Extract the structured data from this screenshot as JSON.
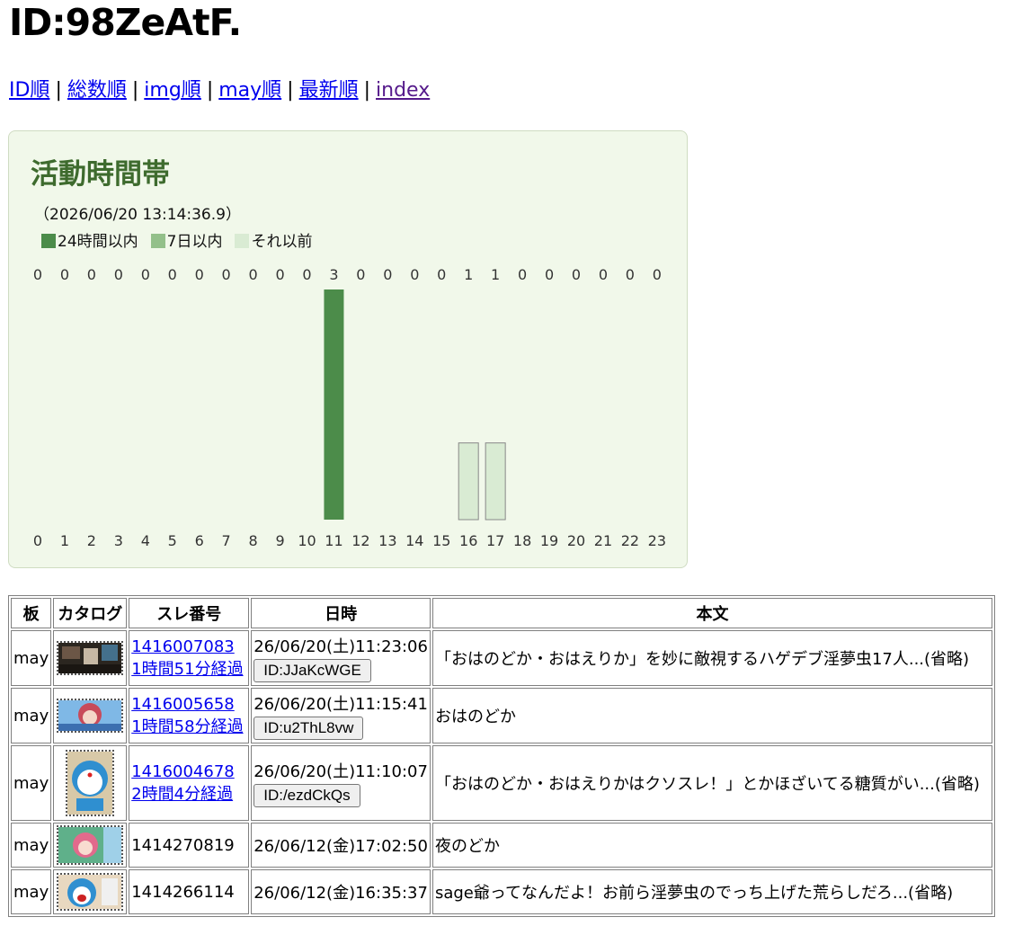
{
  "page": {
    "title": "ID:98ZeAtF."
  },
  "nav": [
    {
      "label": "ID順",
      "visited": false
    },
    {
      "label": "総数順",
      "visited": false
    },
    {
      "label": "img順",
      "visited": false
    },
    {
      "label": "may順",
      "visited": false
    },
    {
      "label": "最新順",
      "visited": false
    },
    {
      "label": "index",
      "visited": true
    }
  ],
  "nav_separator": "|",
  "activity": {
    "title": "活動時間帯",
    "timestamp": "（2026/06/20 13:14:36.9）",
    "legend": [
      {
        "label": "24時間以内",
        "color": "#4c8c4a"
      },
      {
        "label": "7日以内",
        "color": "#93c08a"
      },
      {
        "label": "それ以前",
        "color": "#d9ebd3"
      }
    ]
  },
  "chart_data": {
    "type": "bar",
    "categories": [
      "0",
      "1",
      "2",
      "3",
      "4",
      "5",
      "6",
      "7",
      "8",
      "9",
      "10",
      "11",
      "12",
      "13",
      "14",
      "15",
      "16",
      "17",
      "18",
      "19",
      "20",
      "21",
      "22",
      "23"
    ],
    "values": [
      0,
      0,
      0,
      0,
      0,
      0,
      0,
      0,
      0,
      0,
      0,
      3,
      0,
      0,
      0,
      0,
      1,
      1,
      0,
      0,
      0,
      0,
      0,
      0
    ],
    "series": [
      {
        "name": "24時間以内",
        "values": [
          0,
          0,
          0,
          0,
          0,
          0,
          0,
          0,
          0,
          0,
          0,
          3,
          0,
          0,
          0,
          0,
          0,
          0,
          0,
          0,
          0,
          0,
          0,
          0
        ]
      },
      {
        "name": "7日以内",
        "values": [
          0,
          0,
          0,
          0,
          0,
          0,
          0,
          0,
          0,
          0,
          0,
          0,
          0,
          0,
          0,
          0,
          0,
          0,
          0,
          0,
          0,
          0,
          0,
          0
        ]
      },
      {
        "name": "それ以前",
        "values": [
          0,
          0,
          0,
          0,
          0,
          0,
          0,
          0,
          0,
          0,
          0,
          0,
          0,
          0,
          0,
          0,
          1,
          1,
          0,
          0,
          0,
          0,
          0,
          0
        ]
      }
    ],
    "ylim": [
      0,
      3
    ],
    "colors": {
      "recent": "#4c8c4a",
      "week": "#93c08a",
      "older": "#d9ebd3",
      "border": "#888888"
    }
  },
  "table": {
    "headers": [
      "板",
      "カタログ",
      "スレ番号",
      "日時",
      "本文"
    ],
    "rows": [
      {
        "board": "may",
        "thumb": "dark-group-thumbnail",
        "thread_no": "1416007083",
        "elapsed": "1時間51分経過",
        "datetime": "26/06/20(土)11:23:06",
        "id_button": "ID:JJaKcWGE",
        "body": "「おはのどか・おはえりか」を妙に敵視するハゲデブ淫夢虫17人...(省略)"
      },
      {
        "board": "may",
        "thumb": "anime-girl-thumbnail",
        "thread_no": "1416005658",
        "elapsed": "1時間58分経過",
        "datetime": "26/06/20(土)11:15:41",
        "id_button": "ID:u2ThL8vw",
        "body": "おはのどか"
      },
      {
        "board": "may",
        "thumb": "doraemon-thumbnail",
        "thread_no": "1416004678",
        "elapsed": "2時間4分経過",
        "datetime": "26/06/20(土)11:10:07",
        "id_button": "ID:/ezdCkQs",
        "body": "「おはのどか・おはえりかはクソスレ！」とかほざいてる糖質がい...(省略)"
      },
      {
        "board": "may",
        "thumb": "anime-girl-green-thumbnail",
        "thread_no": "1414270819",
        "elapsed": "",
        "datetime": "26/06/12(金)17:02:50",
        "id_button": "",
        "body": "夜のどか"
      },
      {
        "board": "may",
        "thumb": "doraemon-shocked-thumbnail",
        "thread_no": "1414266114",
        "elapsed": "",
        "datetime": "26/06/12(金)16:35:37",
        "id_button": "",
        "body": "sage爺ってなんだよ！お前ら淫夢虫のでっち上げた荒らしだろ...(省略)"
      }
    ]
  }
}
